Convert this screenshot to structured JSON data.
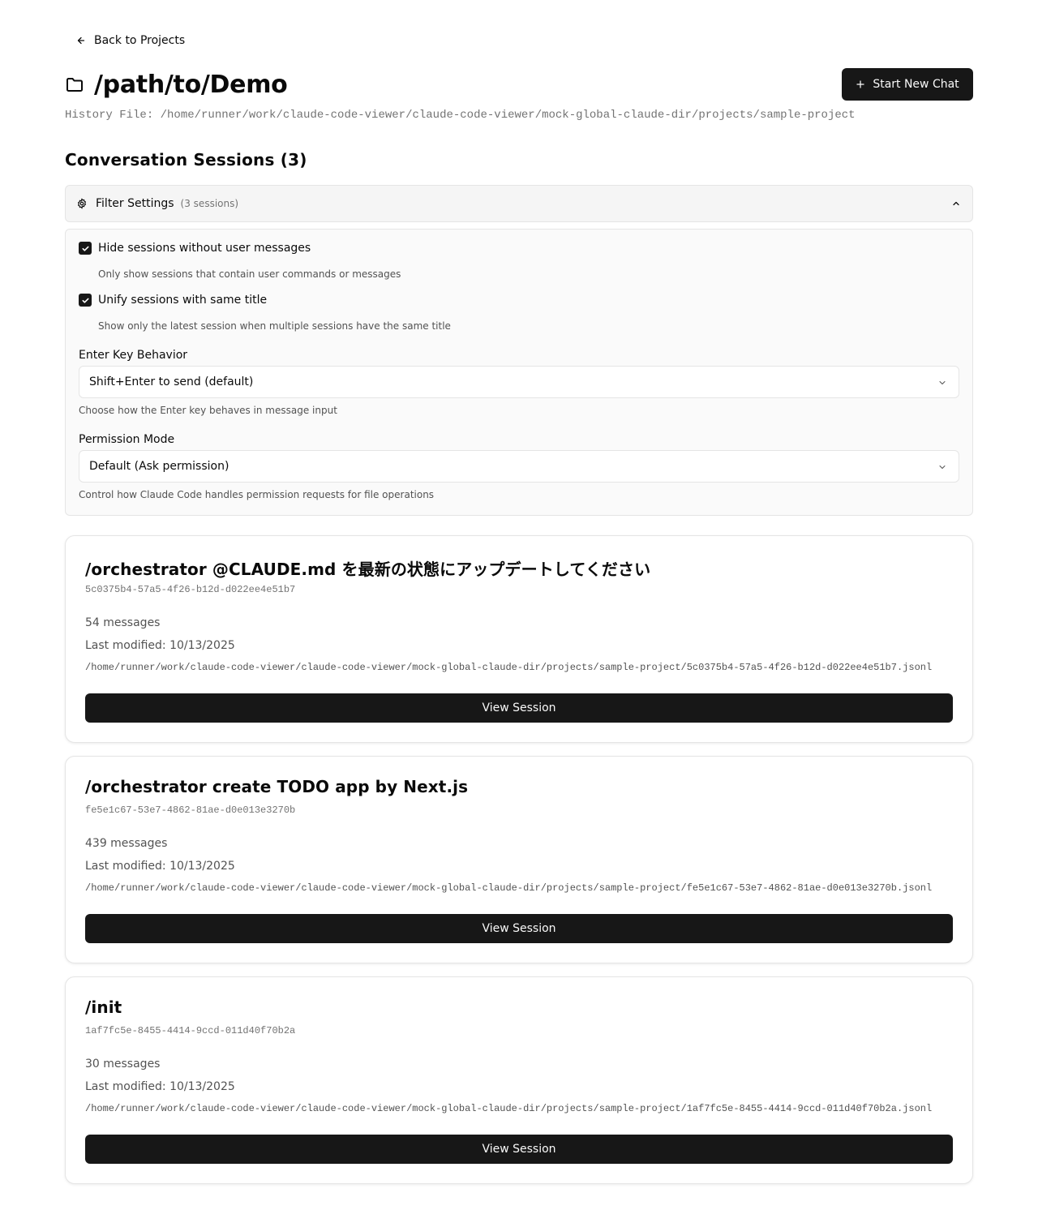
{
  "nav": {
    "back_label": "Back to Projects"
  },
  "project": {
    "title": "/path/to/Demo",
    "history_file": "History File: /home/runner/work/claude-code-viewer/claude-code-viewer/mock-global-claude-dir/projects/sample-project",
    "new_chat_label": "Start New Chat"
  },
  "sessions_heading": "Conversation Sessions (3)",
  "filter": {
    "label": "Filter Settings",
    "count": "(3 sessions)",
    "expanded": true,
    "hide_empty": {
      "label": "Hide sessions without user messages",
      "checked": true,
      "description": "Only show sessions that contain user commands or messages"
    },
    "unify_titles": {
      "label": "Unify sessions with same title",
      "checked": true,
      "description": "Show only the latest session when multiple sessions have the same title"
    },
    "enter_key": {
      "label": "Enter Key Behavior",
      "value": "Shift+Enter to send (default)",
      "help": "Choose how the Enter key behaves in message input"
    },
    "permission": {
      "label": "Permission Mode",
      "value": "Default (Ask permission)",
      "help": "Control how Claude Code handles permission requests for file operations"
    }
  },
  "sessions": [
    {
      "title": "/orchestrator @CLAUDE.md を最新の状態にアップデートしてください",
      "id": "5c0375b4-57a5-4f26-b12d-d022ee4e51b7",
      "messages": "54 messages",
      "modified": "Last modified: 10/13/2025",
      "path": "/home/runner/work/claude-code-viewer/claude-code-viewer/mock-global-claude-dir/projects/sample-project/5c0375b4-57a5-4f26-b12d-d022ee4e51b7.jsonl",
      "button": "View Session"
    },
    {
      "title": "/orchestrator create TODO app by Next.js",
      "id": "fe5e1c67-53e7-4862-81ae-d0e013e3270b",
      "messages": "439 messages",
      "modified": "Last modified: 10/13/2025",
      "path": "/home/runner/work/claude-code-viewer/claude-code-viewer/mock-global-claude-dir/projects/sample-project/fe5e1c67-53e7-4862-81ae-d0e013e3270b.jsonl",
      "button": "View Session"
    },
    {
      "title": "/init",
      "id": "1af7fc5e-8455-4414-9ccd-011d40f70b2a",
      "messages": "30 messages",
      "modified": "Last modified: 10/13/2025",
      "path": "/home/runner/work/claude-code-viewer/claude-code-viewer/mock-global-claude-dir/projects/sample-project/1af7fc5e-8455-4414-9ccd-011d40f70b2a.jsonl",
      "button": "View Session"
    }
  ],
  "icons": {
    "back": "arrow-left-icon",
    "folder": "folder-icon",
    "new_chat": "plus-icon",
    "filter": "gear-icon",
    "collapse": "chevron-up-icon",
    "dropdown": "chevron-down-icon",
    "checkbox": "check-icon"
  },
  "colors": {
    "primary": "#171717",
    "muted_text": "#737373",
    "border": "#e5e5e5",
    "panel_bg": "#fafafa"
  }
}
